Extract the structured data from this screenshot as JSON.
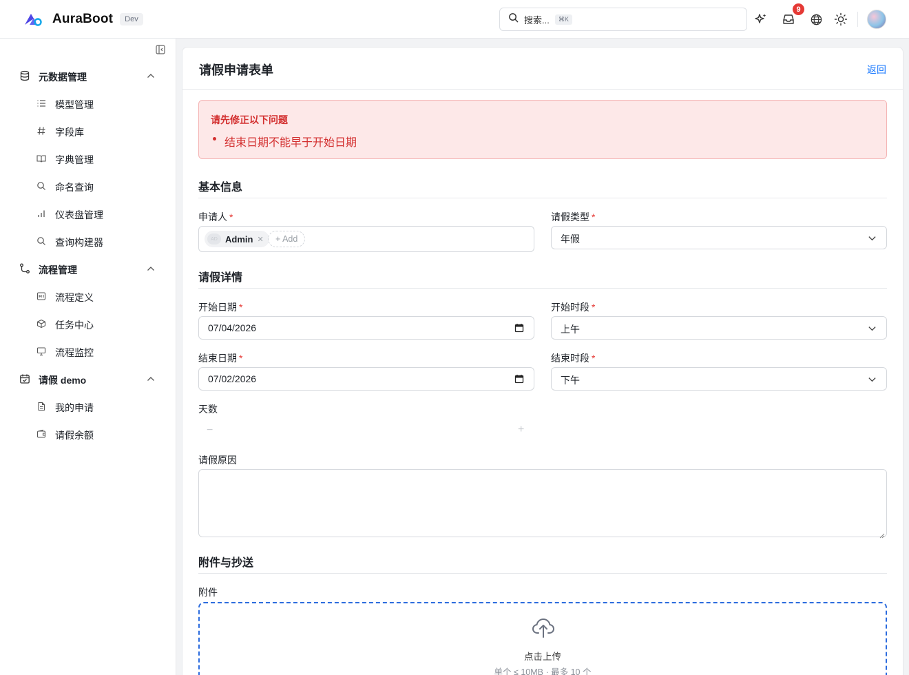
{
  "header": {
    "brand": "AuraBoot",
    "env_badge": "Dev",
    "search_placeholder": "搜索...",
    "search_shortcut": "⌘K",
    "notification_count": "9",
    "accent_color": "#1677ff"
  },
  "sidebar": {
    "groups": [
      {
        "label": "元数据管理",
        "icon": "database-icon",
        "items": [
          {
            "label": "模型管理",
            "icon": "list-icon"
          },
          {
            "label": "字段库",
            "icon": "hash-icon"
          },
          {
            "label": "字典管理",
            "icon": "book-icon"
          },
          {
            "label": "命名查询",
            "icon": "search-icon"
          },
          {
            "label": "仪表盘管理",
            "icon": "bar-chart-icon"
          },
          {
            "label": "查询构建器",
            "icon": "search-icon"
          }
        ]
      },
      {
        "label": "流程管理",
        "icon": "workflow-icon",
        "items": [
          {
            "label": "流程定义",
            "icon": "flow-icon"
          },
          {
            "label": "任务中心",
            "icon": "cube-icon"
          },
          {
            "label": "流程监控",
            "icon": "monitor-icon"
          }
        ]
      },
      {
        "label": "请假 demo",
        "icon": "calendar-icon",
        "items": [
          {
            "label": "我的申请",
            "icon": "document-icon"
          },
          {
            "label": "请假余额",
            "icon": "wallet-icon"
          }
        ]
      }
    ]
  },
  "page": {
    "title": "请假申请表单",
    "back": "返回"
  },
  "errors": {
    "title": "请先修正以下问题",
    "items": [
      "结束日期不能早于开始日期"
    ],
    "color": "#d32f2f"
  },
  "sections": {
    "basic": "基本信息",
    "details": "请假详情",
    "attachments": "附件与抄送"
  },
  "fields": {
    "applicant": {
      "label": "申请人",
      "chip_avatar": "AD",
      "chip_name": "Admin",
      "add_label": "+ Add"
    },
    "leave_type": {
      "label": "请假类型",
      "value": "年假"
    },
    "start_date": {
      "label": "开始日期",
      "value": "07/04/2026"
    },
    "start_period": {
      "label": "开始时段",
      "value": "上午"
    },
    "end_date": {
      "label": "结束日期",
      "value": "07/02/2026"
    },
    "end_period": {
      "label": "结束时段",
      "value": "下午"
    },
    "days": {
      "label": "天数",
      "minus": "−",
      "plus": "+"
    },
    "reason": {
      "label": "请假原因",
      "value": ""
    },
    "attachment": {
      "label": "附件",
      "upload_text": "点击上传",
      "upload_hint": "单个 ≤ 10MB · 最多 10 个"
    }
  },
  "required_mark": "*"
}
